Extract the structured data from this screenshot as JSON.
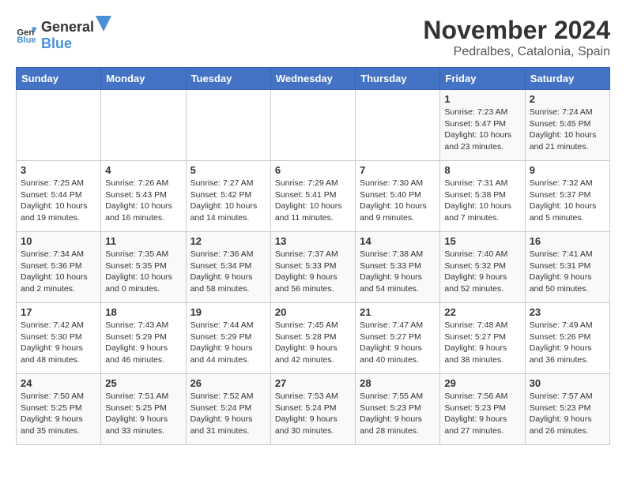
{
  "logo": {
    "general": "General",
    "blue": "Blue"
  },
  "title": {
    "month": "November 2024",
    "location": "Pedralbes, Catalonia, Spain"
  },
  "headers": [
    "Sunday",
    "Monday",
    "Tuesday",
    "Wednesday",
    "Thursday",
    "Friday",
    "Saturday"
  ],
  "weeks": [
    [
      {
        "day": "",
        "info": ""
      },
      {
        "day": "",
        "info": ""
      },
      {
        "day": "",
        "info": ""
      },
      {
        "day": "",
        "info": ""
      },
      {
        "day": "",
        "info": ""
      },
      {
        "day": "1",
        "info": "Sunrise: 7:23 AM\nSunset: 5:47 PM\nDaylight: 10 hours and 23 minutes."
      },
      {
        "day": "2",
        "info": "Sunrise: 7:24 AM\nSunset: 5:45 PM\nDaylight: 10 hours and 21 minutes."
      }
    ],
    [
      {
        "day": "3",
        "info": "Sunrise: 7:25 AM\nSunset: 5:44 PM\nDaylight: 10 hours and 19 minutes."
      },
      {
        "day": "4",
        "info": "Sunrise: 7:26 AM\nSunset: 5:43 PM\nDaylight: 10 hours and 16 minutes."
      },
      {
        "day": "5",
        "info": "Sunrise: 7:27 AM\nSunset: 5:42 PM\nDaylight: 10 hours and 14 minutes."
      },
      {
        "day": "6",
        "info": "Sunrise: 7:29 AM\nSunset: 5:41 PM\nDaylight: 10 hours and 11 minutes."
      },
      {
        "day": "7",
        "info": "Sunrise: 7:30 AM\nSunset: 5:40 PM\nDaylight: 10 hours and 9 minutes."
      },
      {
        "day": "8",
        "info": "Sunrise: 7:31 AM\nSunset: 5:38 PM\nDaylight: 10 hours and 7 minutes."
      },
      {
        "day": "9",
        "info": "Sunrise: 7:32 AM\nSunset: 5:37 PM\nDaylight: 10 hours and 5 minutes."
      }
    ],
    [
      {
        "day": "10",
        "info": "Sunrise: 7:34 AM\nSunset: 5:36 PM\nDaylight: 10 hours and 2 minutes."
      },
      {
        "day": "11",
        "info": "Sunrise: 7:35 AM\nSunset: 5:35 PM\nDaylight: 10 hours and 0 minutes."
      },
      {
        "day": "12",
        "info": "Sunrise: 7:36 AM\nSunset: 5:34 PM\nDaylight: 9 hours and 58 minutes."
      },
      {
        "day": "13",
        "info": "Sunrise: 7:37 AM\nSunset: 5:33 PM\nDaylight: 9 hours and 56 minutes."
      },
      {
        "day": "14",
        "info": "Sunrise: 7:38 AM\nSunset: 5:33 PM\nDaylight: 9 hours and 54 minutes."
      },
      {
        "day": "15",
        "info": "Sunrise: 7:40 AM\nSunset: 5:32 PM\nDaylight: 9 hours and 52 minutes."
      },
      {
        "day": "16",
        "info": "Sunrise: 7:41 AM\nSunset: 5:31 PM\nDaylight: 9 hours and 50 minutes."
      }
    ],
    [
      {
        "day": "17",
        "info": "Sunrise: 7:42 AM\nSunset: 5:30 PM\nDaylight: 9 hours and 48 minutes."
      },
      {
        "day": "18",
        "info": "Sunrise: 7:43 AM\nSunset: 5:29 PM\nDaylight: 9 hours and 46 minutes."
      },
      {
        "day": "19",
        "info": "Sunrise: 7:44 AM\nSunset: 5:29 PM\nDaylight: 9 hours and 44 minutes."
      },
      {
        "day": "20",
        "info": "Sunrise: 7:45 AM\nSunset: 5:28 PM\nDaylight: 9 hours and 42 minutes."
      },
      {
        "day": "21",
        "info": "Sunrise: 7:47 AM\nSunset: 5:27 PM\nDaylight: 9 hours and 40 minutes."
      },
      {
        "day": "22",
        "info": "Sunrise: 7:48 AM\nSunset: 5:27 PM\nDaylight: 9 hours and 38 minutes."
      },
      {
        "day": "23",
        "info": "Sunrise: 7:49 AM\nSunset: 5:26 PM\nDaylight: 9 hours and 36 minutes."
      }
    ],
    [
      {
        "day": "24",
        "info": "Sunrise: 7:50 AM\nSunset: 5:25 PM\nDaylight: 9 hours and 35 minutes."
      },
      {
        "day": "25",
        "info": "Sunrise: 7:51 AM\nSunset: 5:25 PM\nDaylight: 9 hours and 33 minutes."
      },
      {
        "day": "26",
        "info": "Sunrise: 7:52 AM\nSunset: 5:24 PM\nDaylight: 9 hours and 31 minutes."
      },
      {
        "day": "27",
        "info": "Sunrise: 7:53 AM\nSunset: 5:24 PM\nDaylight: 9 hours and 30 minutes."
      },
      {
        "day": "28",
        "info": "Sunrise: 7:55 AM\nSunset: 5:23 PM\nDaylight: 9 hours and 28 minutes."
      },
      {
        "day": "29",
        "info": "Sunrise: 7:56 AM\nSunset: 5:23 PM\nDaylight: 9 hours and 27 minutes."
      },
      {
        "day": "30",
        "info": "Sunrise: 7:57 AM\nSunset: 5:23 PM\nDaylight: 9 hours and 26 minutes."
      }
    ]
  ]
}
